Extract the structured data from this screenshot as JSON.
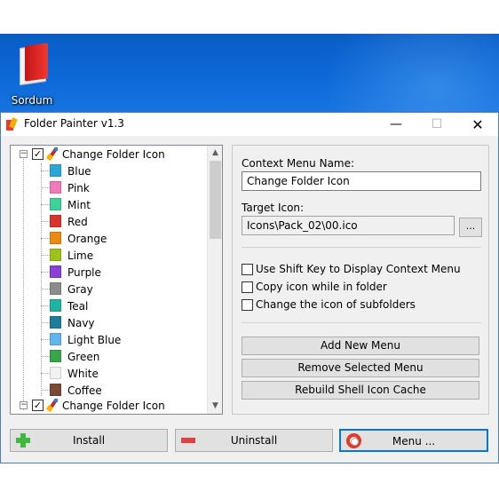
{
  "desktop": {
    "icon_label": "Sordum"
  },
  "window": {
    "title": "Folder Painter v1.3",
    "minimize": "—",
    "maximize": "☐",
    "close": "✕"
  },
  "tree": {
    "group_label": "Change Folder Icon",
    "items": [
      {
        "label": "Blue",
        "color": "#2aa7d8"
      },
      {
        "label": "Pink",
        "color": "#f07ab6"
      },
      {
        "label": "Mint",
        "color": "#3ed29a"
      },
      {
        "label": "Red",
        "color": "#d9342b"
      },
      {
        "label": "Orange",
        "color": "#ea8a12"
      },
      {
        "label": "Lime",
        "color": "#9ec21a"
      },
      {
        "label": "Purple",
        "color": "#8a3fd6"
      },
      {
        "label": "Gray",
        "color": "#8c8c8c"
      },
      {
        "label": "Teal",
        "color": "#1fb3a3"
      },
      {
        "label": "Navy",
        "color": "#1a7d9c"
      },
      {
        "label": "Light Blue",
        "color": "#62b4ee"
      },
      {
        "label": "Green",
        "color": "#3aa64a"
      },
      {
        "label": "White",
        "color": "#f2f2f2"
      },
      {
        "label": "Coffee",
        "color": "#7a4a32"
      }
    ],
    "group2_label": "Change Folder Icon"
  },
  "panel": {
    "context_menu_label": "Context Menu Name:",
    "context_menu_value": "Change Folder Icon",
    "target_icon_label": "Target Icon:",
    "target_icon_value": "Icons\\Pack_02\\00.ico",
    "browse_label": "...",
    "options": [
      {
        "label": "Use Shift Key to Display Context Menu",
        "checked": false
      },
      {
        "label": "Copy icon while in folder",
        "checked": false
      },
      {
        "label": "Change the icon of subfolders",
        "checked": false
      }
    ],
    "add_new_menu": "Add New Menu",
    "remove_selected_menu": "Remove Selected Menu",
    "rebuild_cache": "Rebuild Shell Icon Cache"
  },
  "bottom": {
    "install": "Install",
    "uninstall": "Uninstall",
    "menu": "Menu ..."
  }
}
